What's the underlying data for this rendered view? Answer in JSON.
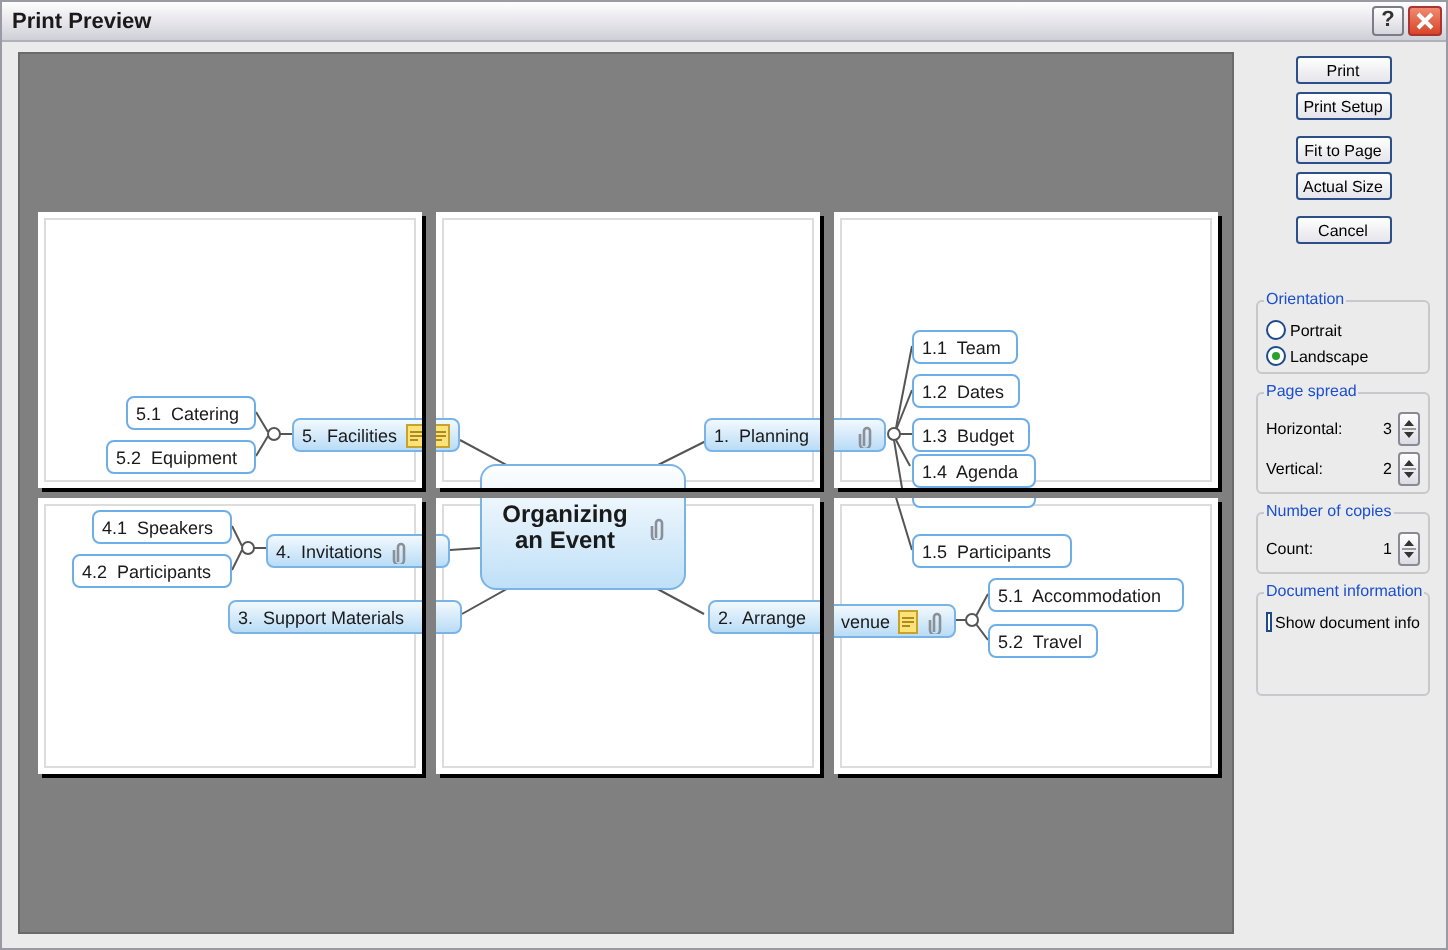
{
  "window": {
    "title": "Print Preview",
    "help": "?"
  },
  "button_groups": [
    [
      {
        "label": "Print"
      },
      {
        "label": "Print Setup"
      }
    ],
    [
      {
        "label": "Fit to Page"
      },
      {
        "label": "Actual Size"
      }
    ],
    [
      {
        "label": "Cancel"
      }
    ]
  ],
  "orientation": {
    "title": "Orientation",
    "options": [
      {
        "label": "Portrait",
        "selected": false
      },
      {
        "label": "Landscape",
        "selected": true
      }
    ]
  },
  "page_spread": {
    "title": "Page spread",
    "fields": [
      {
        "label": "Horizontal:",
        "value": "3"
      },
      {
        "label": "Vertical:",
        "value": "2"
      }
    ]
  },
  "copies": {
    "title": "Number of copies",
    "fields": [
      {
        "label": "Count:",
        "value": "1"
      }
    ]
  },
  "document_information": {
    "title": "Document information",
    "checkbox": {
      "label": "Show document info",
      "checked": false
    }
  },
  "pages": [
    {
      "nodes": [
        {
          "kind": "subtopic",
          "text": "5.1  Catering",
          "note": false,
          "attachment": false
        },
        {
          "kind": "subtopic",
          "text": "5.2  Equipment",
          "note": false,
          "attachment": false
        },
        {
          "kind": "topic",
          "text": "5.  Facilities",
          "note": true,
          "attachment": false
        }
      ]
    },
    {
      "nodes": [
        {
          "kind": "topic",
          "note": true,
          "attachment": false
        },
        {
          "kind": "topic",
          "text": "1.  Planning",
          "note": false
        },
        {
          "kind": "central"
        }
      ]
    },
    {
      "nodes": [
        {
          "kind": "topic",
          "note": false,
          "attachment": true
        },
        {
          "kind": "subtopic",
          "text": "1.1  Team",
          "note": false,
          "attachment": false
        },
        {
          "kind": "subtopic",
          "text": "1.2  Dates",
          "note": false,
          "attachment": false
        },
        {
          "kind": "subtopic",
          "text": "1.3  Budget",
          "note": false,
          "attachment": false
        },
        {
          "kind": "subtopic",
          "text": "1.4  Agenda",
          "note": false,
          "attachment": false
        }
      ]
    },
    {
      "nodes": [
        {
          "kind": "subtopic",
          "text": "4.1  Speakers",
          "note": false,
          "attachment": false
        },
        {
          "kind": "subtopic",
          "text": "4.2  Participants",
          "note": false,
          "attachment": false
        },
        {
          "kind": "topic",
          "text": "4.  Invitations",
          "note": false,
          "attachment": true
        },
        {
          "kind": "topic",
          "text": "3.  Support Materials",
          "note": false,
          "attachment": false
        }
      ]
    },
    {
      "nodes": [
        {
          "kind": "topic",
          "note": false
        },
        {
          "kind": "topic",
          "note": false,
          "attachment": false
        },
        {
          "kind": "central",
          "text": "Organizing an Event",
          "note": false,
          "attachment": true
        },
        {
          "kind": "topic",
          "text": "2.  Arrange",
          "note": false,
          "attachment": false
        }
      ]
    },
    {
      "nodes": [
        {
          "kind": "subtopic",
          "note": false,
          "attachment": false
        },
        {
          "kind": "subtopic",
          "text": "1.5  Participants",
          "note": false,
          "attachment": false
        },
        {
          "kind": "topic",
          "text": "venue",
          "note": true,
          "attachment": true
        },
        {
          "kind": "subtopic",
          "text": "5.1  Accommodation",
          "note": false,
          "attachment": false
        },
        {
          "kind": "subtopic",
          "text": "5.2  Travel",
          "note": false,
          "attachment": false
        }
      ]
    }
  ]
}
